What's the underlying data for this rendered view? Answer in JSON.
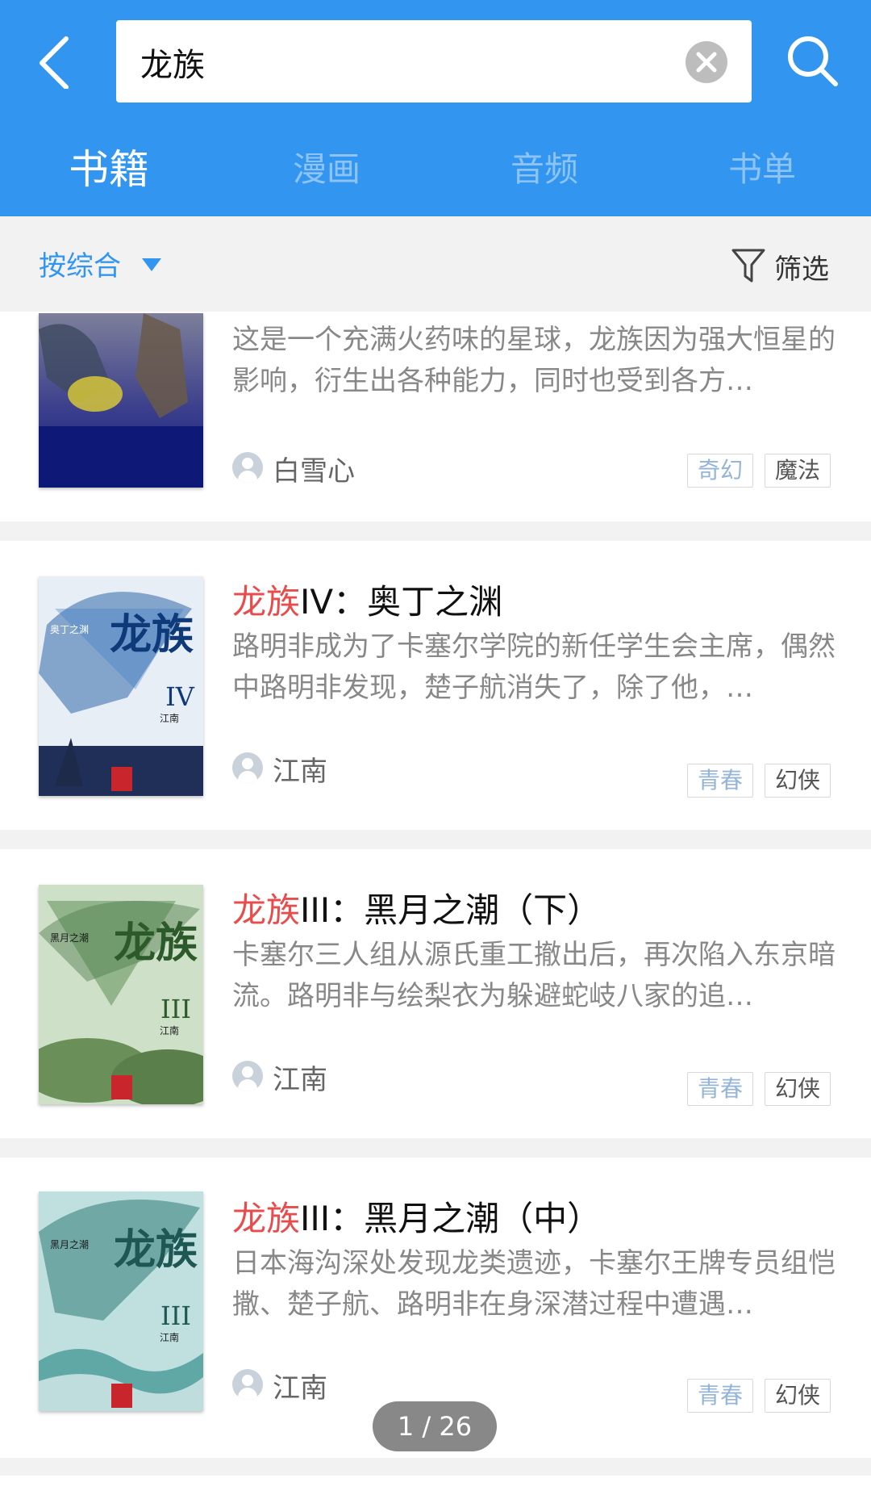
{
  "search": {
    "query": "龙族"
  },
  "tabs": [
    "书籍",
    "漫画",
    "音频",
    "书单"
  ],
  "sort": {
    "label": "按综合",
    "filter_label": "筛选"
  },
  "books": [
    {
      "title_highlight": "",
      "title_rest": "",
      "desc": "这是一个充满火药味的星球，龙族因为强大恒星的影响，衍生出各种能力，同时也受到各方…",
      "author": "白雪心",
      "tags": [
        "奇幻",
        "魔法"
      ]
    },
    {
      "title_highlight": "龙族",
      "title_rest": "IV：奥丁之渊",
      "desc": "路明非成为了卡塞尔学院的新任学生会主席，偶然中路明非发现，楚子航消失了，除了他，…",
      "author": "江南",
      "tags": [
        "青春",
        "幻侠"
      ]
    },
    {
      "title_highlight": "龙族",
      "title_rest": "III：黑月之潮（下）",
      "desc": "卡塞尔三人组从源氏重工撤出后，再次陷入东京暗流。路明非与绘梨衣为躲避蛇岐八家的追…",
      "author": "江南",
      "tags": [
        "青春",
        "幻侠"
      ]
    },
    {
      "title_highlight": "龙族",
      "title_rest": "III：黑月之潮（中）",
      "desc": "日本海沟深处发现龙类遗迹，卡塞尔王牌专员组恺撒、楚子航、路明非在身深潜过程中遭遇…",
      "author": "江南",
      "tags": [
        "青春",
        "幻侠"
      ]
    }
  ],
  "covers": [
    {
      "big": "",
      "roman": ""
    },
    {
      "big": "龙族",
      "roman": "IV",
      "subtitle": "奥丁之渊",
      "author": "江南"
    },
    {
      "big": "龙族",
      "roman": "III",
      "subtitle": "黑月之潮",
      "author": "江南"
    },
    {
      "big": "龙族",
      "roman": "III",
      "subtitle": "黑月之潮",
      "author": "江南"
    }
  ],
  "pager": "1 / 26",
  "colors": {
    "header": "#3296f0",
    "highlight": "#e94c4c",
    "tag_blue": "#94b4d8"
  }
}
